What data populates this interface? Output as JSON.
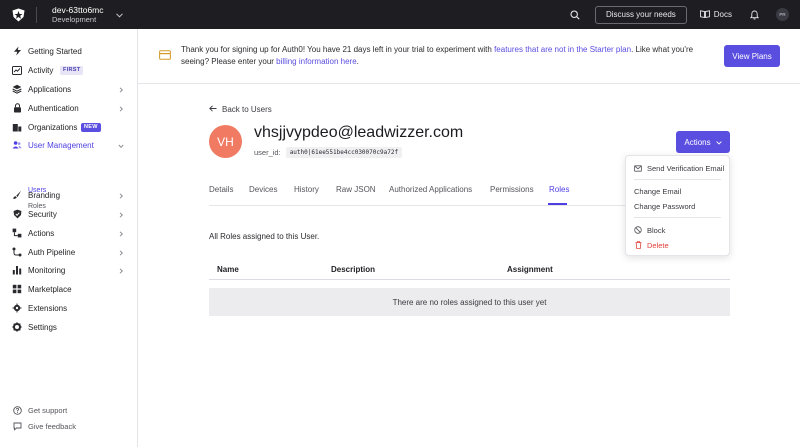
{
  "topbar": {
    "tenant_name": "dev-63tto6mc",
    "tenant_env": "Development",
    "discuss_label": "Discuss your needs",
    "docs_label": "Docs",
    "avatar_initials": "PR"
  },
  "sidebar": {
    "items": [
      {
        "label": "Getting Started"
      },
      {
        "label": "Activity",
        "badge": "FIRST"
      },
      {
        "label": "Applications"
      },
      {
        "label": "Authentication"
      },
      {
        "label": "Organizations",
        "badge": "NEW"
      },
      {
        "label": "User Management"
      },
      {
        "label": "Branding"
      },
      {
        "label": "Security"
      },
      {
        "label": "Actions"
      },
      {
        "label": "Auth Pipeline"
      },
      {
        "label": "Monitoring"
      },
      {
        "label": "Marketplace"
      },
      {
        "label": "Extensions"
      },
      {
        "label": "Settings"
      }
    ],
    "sub_items": [
      "Users",
      "Roles"
    ],
    "footer": [
      {
        "label": "Get support"
      },
      {
        "label": "Give feedback"
      }
    ]
  },
  "banner": {
    "text_1": "Thank you for signing up for Auth0! You have 21 days left in your trial to experiment with ",
    "link_1": "features that are not in the Starter plan",
    "text_2": ". Like what you're seeing? Please enter your ",
    "link_2": "billing information here",
    "text_3": ".",
    "button_label": "View Plans"
  },
  "user": {
    "back_label": "Back to Users",
    "initials": "VH",
    "email": "vhsjjvypdeo@leadwizzer.com",
    "user_id_label": "user_id:",
    "user_id": "auth0|61ee551be4cc030070c9a72f",
    "actions_label": "Actions"
  },
  "tabs": [
    {
      "label": "Details"
    },
    {
      "label": "Devices"
    },
    {
      "label": "History"
    },
    {
      "label": "Raw JSON"
    },
    {
      "label": "Authorized Applications"
    },
    {
      "label": "Permissions"
    },
    {
      "label": "Roles",
      "active": true
    }
  ],
  "roles": {
    "description": "All Roles assigned to this User.",
    "columns": [
      "Name",
      "Description",
      "Assignment"
    ],
    "empty_message": "There are no roles assigned to this user yet"
  },
  "actions_menu": [
    {
      "label": "Send Verification Email",
      "icon": "mail-icon"
    },
    {
      "label": "Change Email"
    },
    {
      "label": "Change Password"
    },
    {
      "label": "Block",
      "icon": "block-icon"
    },
    {
      "label": "Delete",
      "icon": "trash-icon",
      "danger": true
    }
  ],
  "colors": {
    "accent": "#5a4ee0",
    "topbar": "#1e1e22",
    "avatar": "#f07a62",
    "danger": "#e0433b"
  }
}
